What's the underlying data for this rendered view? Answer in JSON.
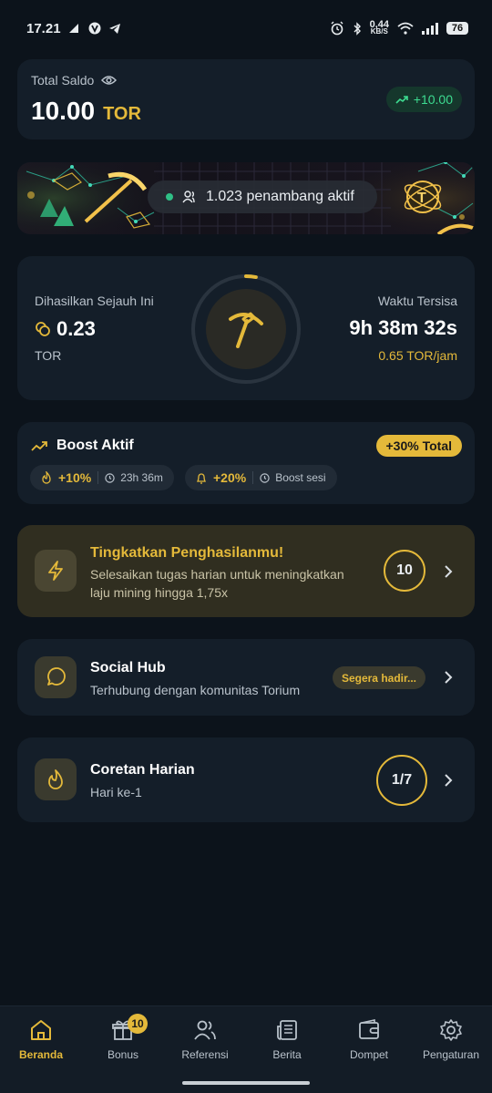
{
  "status_bar": {
    "time": "17.21",
    "net_speed_value": "0,44",
    "net_speed_unit": "KB/S",
    "battery": "76"
  },
  "balance": {
    "label": "Total Saldo",
    "amount": "10.00",
    "unit": "TOR",
    "delta": "+10.00"
  },
  "banner": {
    "miners_text": "1.023 penambang aktif"
  },
  "mining": {
    "mined_label": "Dihasilkan Sejauh Ini",
    "mined_value": "0.23",
    "mined_unit": "TOR",
    "time_label": "Waktu Tersisa",
    "time_value": "9h 38m 32s",
    "rate": "0.65 TOR/jam",
    "progress": 0.03
  },
  "boost": {
    "title": "Boost Aktif",
    "total": "+30% Total",
    "chips": [
      {
        "pct": "+10%",
        "meta": "23h 36m"
      },
      {
        "pct": "+20%",
        "meta": "Boost sesi"
      }
    ]
  },
  "earn": {
    "title": "Tingkatkan Penghasilanmu!",
    "subtitle": "Selesaikan tugas harian untuk meningkatkan laju mining hingga 1,75x",
    "count": "10"
  },
  "social": {
    "title": "Social Hub",
    "subtitle": "Terhubung dengan komunitas Torium",
    "badge": "Segera hadir..."
  },
  "streak": {
    "title": "Coretan Harian",
    "subtitle": "Hari ke-1",
    "progress": "1/7"
  },
  "nav": {
    "items": [
      {
        "label": "Beranda",
        "icon": "home-icon"
      },
      {
        "label": "Bonus",
        "icon": "gift-icon",
        "badge": "10"
      },
      {
        "label": "Referensi",
        "icon": "users-icon"
      },
      {
        "label": "Berita",
        "icon": "news-icon"
      },
      {
        "label": "Dompet",
        "icon": "wallet-icon"
      },
      {
        "label": "Pengaturan",
        "icon": "gear-icon"
      }
    ]
  },
  "colors": {
    "background": "#0c131b",
    "card": "#141e29",
    "accent": "#e4b93a",
    "positive": "#3ddc91"
  }
}
